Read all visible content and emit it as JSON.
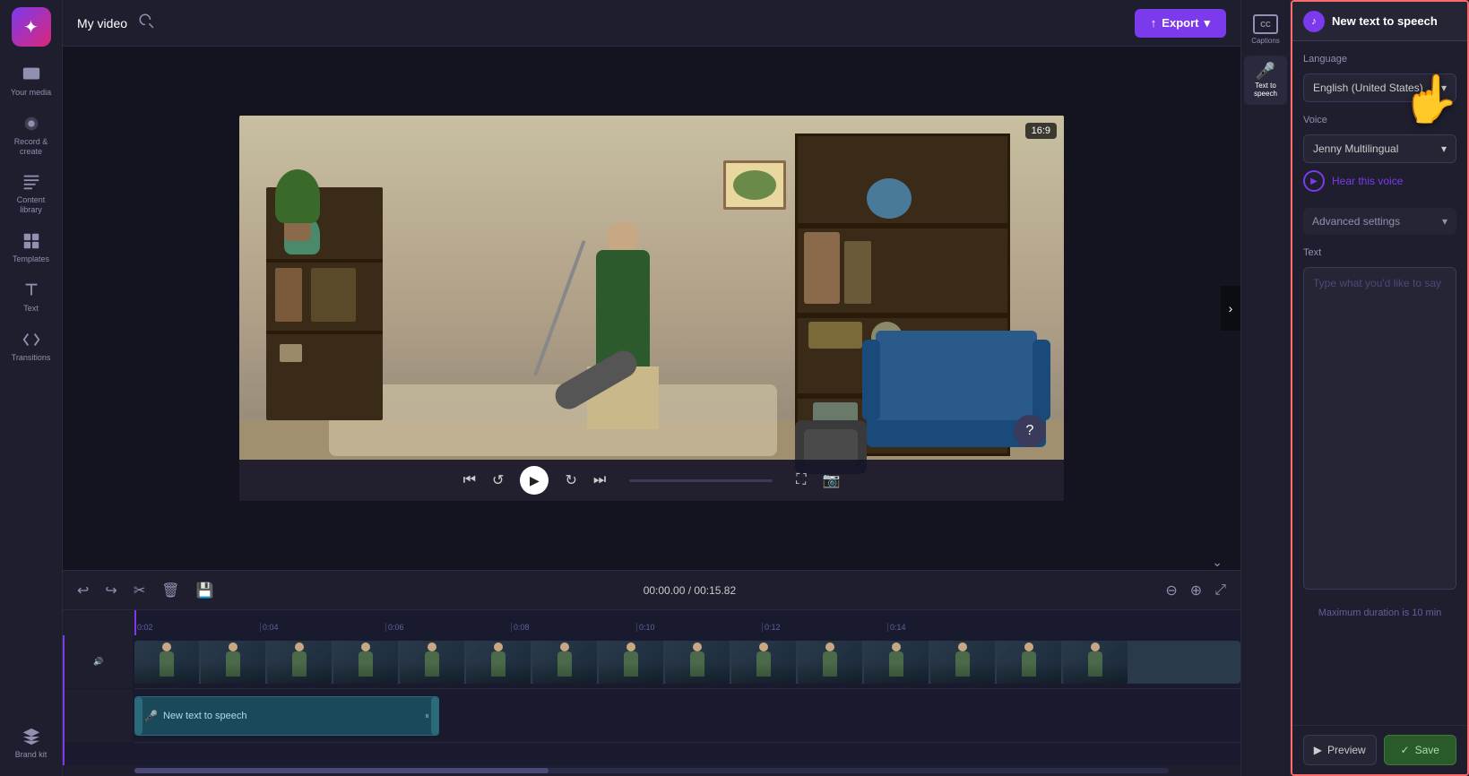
{
  "app": {
    "title": "My video",
    "logo_char": "✦"
  },
  "topbar": {
    "title": "My video",
    "export_label": "Export",
    "export_icon": "↑"
  },
  "sidebar": {
    "items": [
      {
        "id": "your-media",
        "label": "Your media",
        "icon": "▶"
      },
      {
        "id": "record-create",
        "label": "Record & create",
        "icon": "⬤"
      },
      {
        "id": "content-library",
        "label": "Content library",
        "icon": "☰"
      },
      {
        "id": "templates",
        "label": "Templates",
        "icon": "⊞"
      },
      {
        "id": "text",
        "label": "Text",
        "icon": "T"
      },
      {
        "id": "transitions",
        "label": "Transitions",
        "icon": "⇌"
      },
      {
        "id": "brand-kit",
        "label": "Brand kit",
        "icon": "◈"
      }
    ]
  },
  "video": {
    "aspect_ratio": "16:9",
    "scene_description": "Person vacuuming living room"
  },
  "video_controls": {
    "skip_back": "⏮",
    "replay": "↺",
    "play": "▶",
    "forward": "↻",
    "skip_forward": "⏭",
    "fullscreen": "⛶"
  },
  "timeline": {
    "current_time": "00:00.00",
    "total_time": "00:15.82",
    "ruler_marks": [
      "0:02",
      "0:04",
      "0:06",
      "0:08",
      "0:10",
      "0:12",
      "0:14"
    ],
    "speech_clip_label": "New text to speech"
  },
  "tts_panel": {
    "header_title": "New text to speech",
    "language_label": "Language",
    "language_value": "English (United States)",
    "voice_label": "Voice",
    "voice_value": "Jenny Multilingual",
    "hear_voice_label": "Hear this voice",
    "advanced_settings_label": "Advanced settings",
    "text_label": "Text",
    "text_placeholder": "Type what you'd like to say",
    "max_duration_text": "Maximum duration is 10 min",
    "preview_label": "Preview",
    "save_label": "Save"
  },
  "right_tabs": [
    {
      "id": "captions",
      "label": "Captions",
      "icon": "CC"
    },
    {
      "id": "text-to-speech",
      "label": "Text to speech",
      "icon": "🎤"
    }
  ]
}
